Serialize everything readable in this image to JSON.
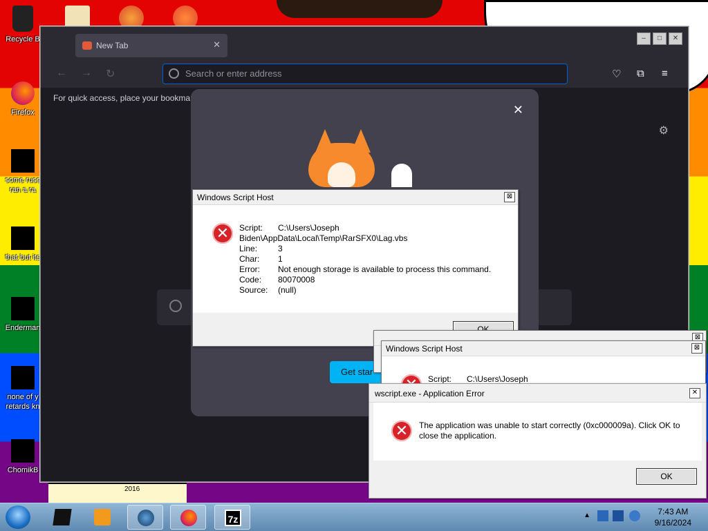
{
  "desktop": {
    "icons": [
      {
        "label": "Recycle B"
      },
      {
        "label": "Firefox"
      },
      {
        "label": "some russ",
        "label2": "ran a ra"
      },
      {
        "label": "that but its"
      },
      {
        "label": "Enderman"
      },
      {
        "label": "none of y",
        "label2": "retards kn"
      },
      {
        "label": "ChomikB"
      }
    ],
    "bottom_label": "2016"
  },
  "browser": {
    "tab_title": "New Tab",
    "tab_close": "✕",
    "url_placeholder": "Search or enter address",
    "bookmarks_hint": "For quick access, place your bookmar",
    "modal_close": "✕",
    "get_started_label": "Get star"
  },
  "dialog1": {
    "title": "Windows Script Host",
    "close": "⊠",
    "rows": [
      {
        "key": "Script:",
        "value": "C:\\Users\\Joseph"
      },
      {
        "key": "",
        "value": "Biden\\AppData\\Local\\Temp\\RarSFX0\\Lag.vbs"
      },
      {
        "key": "Line:",
        "value": "3"
      },
      {
        "key": "Char:",
        "value": "1"
      },
      {
        "key": "Error:",
        "value": "Not enough storage is available to process this command."
      },
      {
        "key": "Code:",
        "value": "80070008"
      },
      {
        "key": "Source:",
        "value": "(null)"
      }
    ],
    "ok": "OK"
  },
  "dialog2": {
    "title": "Windows Script Host",
    "close": "⊠",
    "script_key": "Script:",
    "script_value": "C:\\Users\\Joseph"
  },
  "dialog3": {
    "title": "wscript.exe - Application Error",
    "close": "✕",
    "message": "The application was unable to start correctly (0xc000009a). Click OK to close the application.",
    "ok": "OK"
  },
  "taskbar": {
    "time": "7:43 AM",
    "date": "9/16/2024",
    "sevenzip_label": "7z"
  }
}
